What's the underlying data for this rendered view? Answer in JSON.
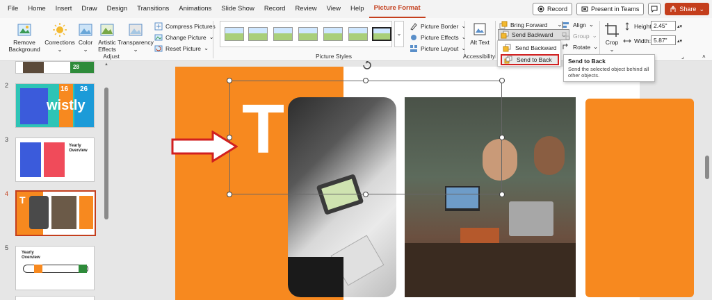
{
  "menu": {
    "items": [
      "File",
      "Home",
      "Insert",
      "Draw",
      "Design",
      "Transitions",
      "Animations",
      "Slide Show",
      "Record",
      "Review",
      "View",
      "Help",
      "Picture Format"
    ],
    "active": "Picture Format",
    "record_label": "Record",
    "present_label": "Present in Teams",
    "share_label": "Share"
  },
  "ribbon": {
    "adjust": {
      "remove_background": "Remove Background",
      "corrections": "Corrections",
      "color": "Color",
      "artistic_effects": "Artistic Effects",
      "transparency": "Transparency",
      "compress": "Compress Pictures",
      "change": "Change Picture",
      "reset": "Reset Picture",
      "group_label": "Adjust"
    },
    "styles": {
      "border": "Picture Border",
      "effects": "Picture Effects",
      "layout": "Picture Layout",
      "group_label": "Picture Styles"
    },
    "accessibility": {
      "alt_text": "Alt Text",
      "group_label": "Accessibility"
    },
    "arrange": {
      "bring_forward": "Bring Forward",
      "send_backward": "Send Backward",
      "align": "Align",
      "group": "Group",
      "rotate": "Rotate"
    },
    "size": {
      "crop": "Crop",
      "height_label": "Height:",
      "height_value": "2.45\"",
      "width_label": "Width:",
      "width_value": "5.87\""
    }
  },
  "dropdown": {
    "send_backward": "Send Backward",
    "send_to_back": "Send to Back"
  },
  "tooltip": {
    "title": "Send to Back",
    "description": "Send the selected object behind all other objects."
  },
  "slides": {
    "numbers": [
      "2",
      "3",
      "4",
      "5"
    ],
    "active": "4",
    "thumb2_number": "16",
    "thumb2_number2": "26",
    "thumb2_text": "wistly",
    "thumb3_title": "Yearly Overview",
    "thumb5_title": "Yearly Overview",
    "thumb1_number": "28"
  },
  "slide_content": {
    "big_letter": "T"
  },
  "colors": {
    "accent": "#c43e1c",
    "orange": "#f7891f",
    "highlight": "#d11f1f"
  }
}
